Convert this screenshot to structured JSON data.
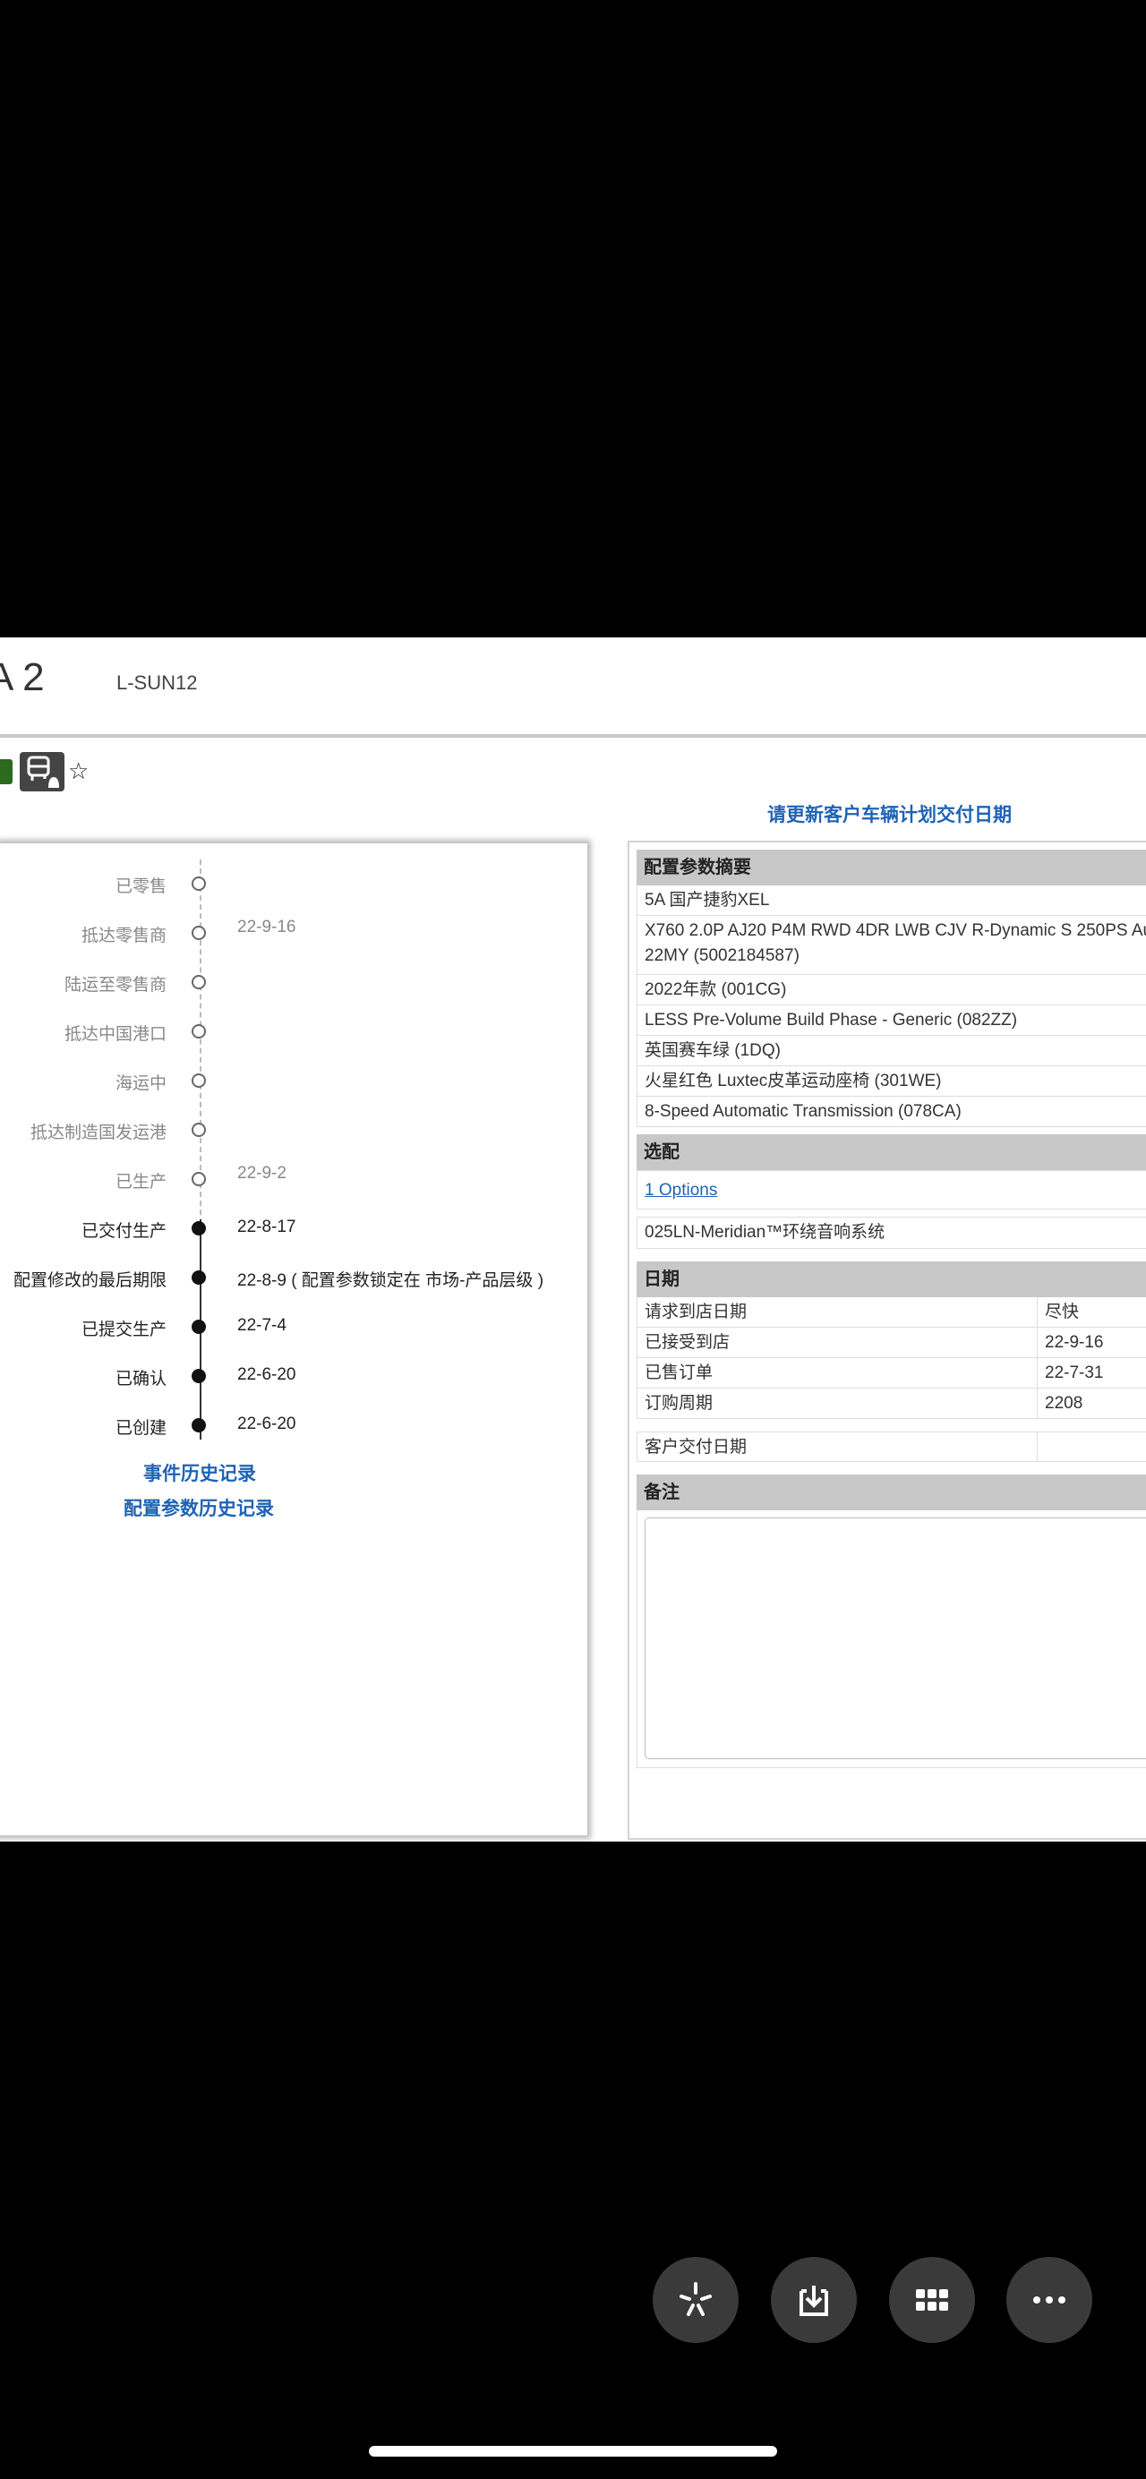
{
  "header": {
    "title": "A 2",
    "code": "L-SUN12"
  },
  "update_link": "请更新客户车辆计划交付日期",
  "timeline": [
    {
      "label": "已零售",
      "date": "",
      "state": "pending"
    },
    {
      "label": "抵达零售商",
      "date": "22-9-16",
      "state": "pending"
    },
    {
      "label": "陆运至零售商",
      "date": "",
      "state": "pending"
    },
    {
      "label": "抵达中国港口",
      "date": "",
      "state": "pending"
    },
    {
      "label": "海运中",
      "date": "",
      "state": "pending"
    },
    {
      "label": "抵达制造国发运港",
      "date": "",
      "state": "pending"
    },
    {
      "label": "已生产",
      "date": "22-9-2",
      "state": "pending"
    },
    {
      "label": "已交付生产",
      "date": "22-8-17",
      "state": "done"
    },
    {
      "label": "配置修改的最后期限",
      "date": "22-8-9 ( 配置参数锁定在 市场-产品层级 )",
      "state": "done"
    },
    {
      "label": "已提交生产",
      "date": "22-7-4",
      "state": "done"
    },
    {
      "label": "已确认",
      "date": "22-6-20",
      "state": "done"
    },
    {
      "label": "已创建",
      "date": "22-6-20",
      "state": "done"
    }
  ],
  "history_links": {
    "event": "事件历史记录",
    "config": "配置参数历史记录"
  },
  "config_summary": {
    "header": "配置参数摘要",
    "rows": [
      "5A 国产捷豹XEL",
      "X760 2.0P AJ20 P4M RWD 4DR LWB CJV R-Dynamic S 250PS Au 22MY (5002184587)",
      "2022年款 (001CG)",
      "LESS Pre-Volume Build Phase - Generic (082ZZ)",
      "英国赛车绿 (1DQ)",
      "火星红色 Luxtec皮革运动座椅 (301WE)",
      "8-Speed Automatic Transmission (078CA)"
    ]
  },
  "options": {
    "header": "选配",
    "link": "1 Options",
    "rows": [
      "025LN-Meridian™环绕音响系统"
    ]
  },
  "dates": {
    "header": "日期",
    "rows": [
      {
        "label": "请求到店日期",
        "value": "尽快"
      },
      {
        "label": "已接受到店",
        "value": "22-9-16"
      },
      {
        "label": "已售订单",
        "value": "22-7-31"
      },
      {
        "label": "订购周期",
        "value": "2208"
      }
    ],
    "delivery": {
      "label": "客户交付日期",
      "value": ""
    }
  },
  "notes": {
    "header": "备注"
  },
  "bottom_buttons": [
    {
      "icon": "sparkle-icon"
    },
    {
      "icon": "download-icon"
    },
    {
      "icon": "grid-icon"
    },
    {
      "icon": "more-icon"
    }
  ]
}
